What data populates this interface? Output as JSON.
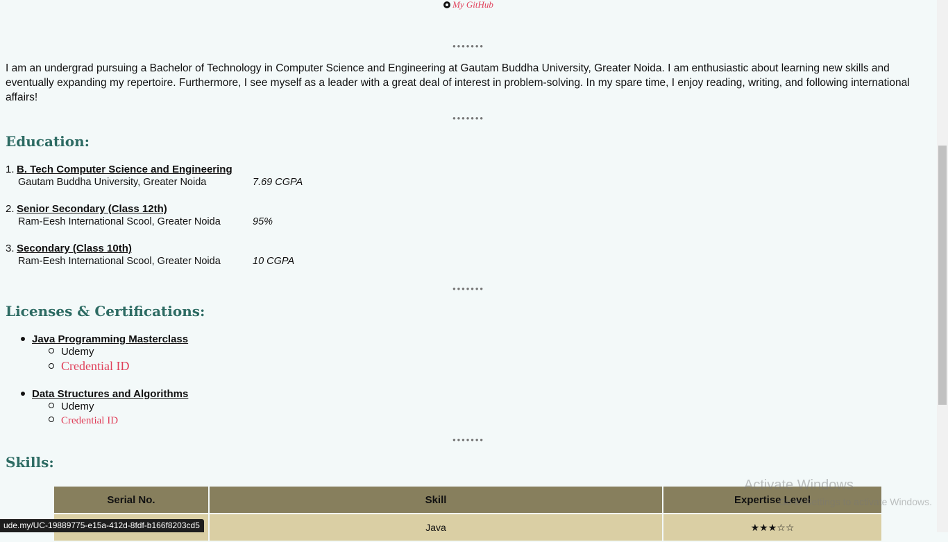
{
  "header": {
    "github_label": "My GitHub"
  },
  "separator": "•••••••",
  "about": {
    "text": "I am an undergrad pursuing a Bachelor of Technology in Computer Science and Engineering at Gautam Buddha University, Greater Noida. I am enthusiastic about learning new skills and eventually expanding my repertoire. Furthermore, I see myself as a leader with a great deal of interest in problem-solving. In my spare time, I enjoy reading, writing, and following international affairs!"
  },
  "education": {
    "heading": "Education:",
    "items": [
      {
        "num": "1.",
        "degree": "B. Tech Computer Science and Engineering",
        "institution": "Gautam Buddha University, Greater Noida",
        "grade": "7.69 CGPA"
      },
      {
        "num": "2.",
        "degree": "Senior Secondary (Class 12th)",
        "institution": "Ram-Eesh International Scool, Greater Noida",
        "grade": "95%"
      },
      {
        "num": "3.",
        "degree": "Secondary (Class 10th)",
        "institution": "Ram-Eesh International Scool, Greater Noida",
        "grade": "10 CGPA"
      }
    ]
  },
  "certifications": {
    "heading": "Licenses & Certifications:",
    "items": [
      {
        "title": "Java Programming Masterclass",
        "issuer": "Udemy",
        "credential_label": "Credential ID"
      },
      {
        "title": "Data Structures and Algorithms",
        "issuer": "Udemy",
        "credential_label": "Credential ID"
      }
    ]
  },
  "skills": {
    "heading": "Skills:",
    "columns": [
      "Serial No.",
      "Skill",
      "Expertise Level"
    ],
    "rows": [
      {
        "serial": "",
        "skill": "Java",
        "level": "★★★☆☆"
      }
    ]
  },
  "watermark": {
    "line1": "Activate Windows",
    "line2": "Go to Settings to activate Windows."
  },
  "status_bar": {
    "url": "ude.my/UC-19889775-e15a-412d-8fdf-b166f8203cd5"
  },
  "colors": {
    "accent": "#e0405a",
    "heading": "#2d6b63",
    "table_header": "#877f5d",
    "table_cell": "#dacfa4",
    "background": "#f3f9f9"
  }
}
